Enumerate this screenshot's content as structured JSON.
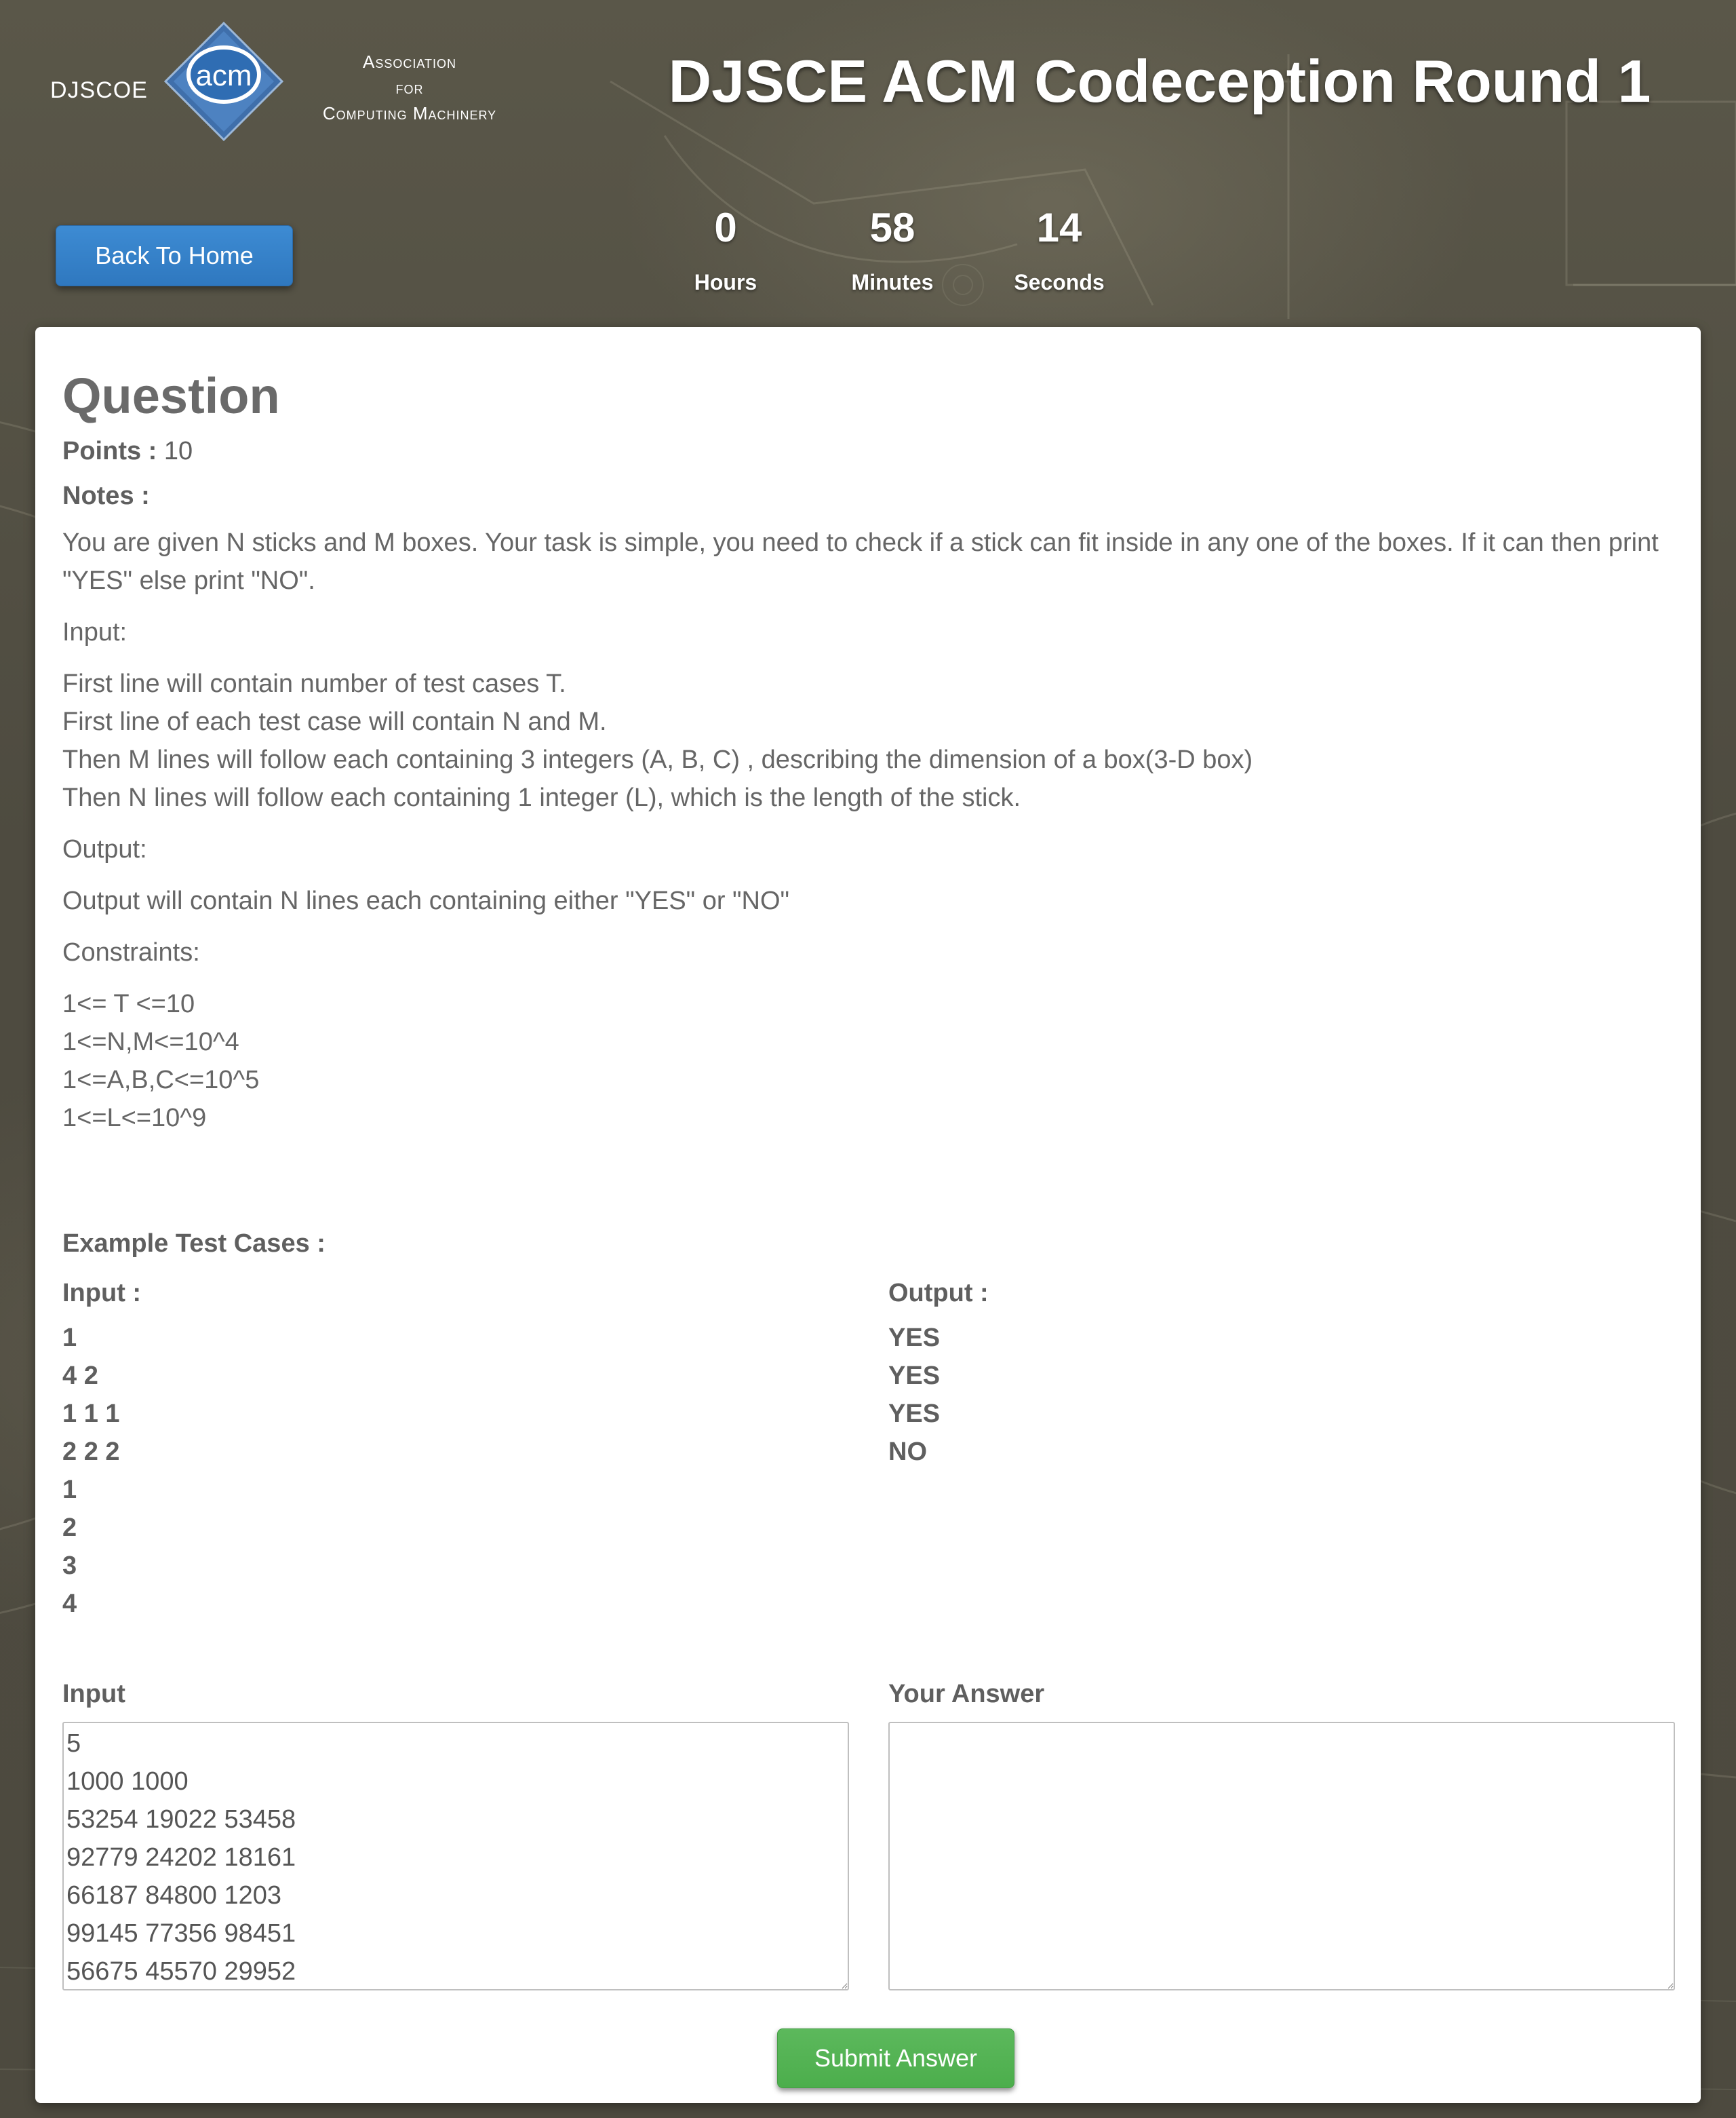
{
  "header": {
    "logo": {
      "djscoe": "DJSCOE",
      "acm": "acm",
      "org_lines": [
        "Association",
        "for",
        "Computing Machinery"
      ]
    },
    "title": "DJSCE ACM Codeception Round 1",
    "back_button": "Back To Home",
    "timer": {
      "hours_value": "0",
      "hours_label": "Hours",
      "minutes_value": "58",
      "minutes_label": "Minutes",
      "seconds_value": "14",
      "seconds_label": "Seconds"
    }
  },
  "question": {
    "heading": "Question",
    "points_label": "Points :",
    "points_value": "10",
    "notes_label": "Notes :",
    "description": "You are given N sticks and M boxes. Your task is simple, you need to check if a stick can fit inside in any one of the boxes. If it can then print \"YES\" else print \"NO\".",
    "input_heading": "Input:",
    "input_lines": [
      "First line will contain number of test cases T.",
      "First line of each test case will contain N and M.",
      "Then M lines will follow each containing 3 integers (A, B, C) , describing the dimension of a box(3-D box)",
      "Then N lines will follow each containing 1 integer (L), which is the length of the stick."
    ],
    "output_heading": "Output:",
    "output_text": "Output will contain N lines each containing either \"YES\" or \"NO\"",
    "constraints_heading": "Constraints:",
    "constraints": [
      "1<= T <=10",
      "1<=N,M<=10^4",
      "1<=A,B,C<=10^5",
      "1<=L<=10^9"
    ]
  },
  "examples": {
    "title": "Example Test Cases :",
    "input_label": "Input :",
    "input_lines": [
      "1",
      "4 2",
      "1 1 1",
      "2 2 2",
      "1",
      "2",
      "3",
      "4"
    ],
    "output_label": "Output :",
    "output_lines": [
      "YES",
      "YES",
      "YES",
      "NO"
    ]
  },
  "answer_form": {
    "input_label": "Input",
    "input_value": "5\n1000 1000\n53254 19022 53458\n92779 24202 18161\n66187 84800 1203\n99145 77356 98451\n56675 45570 29952",
    "answer_label": "Your Answer",
    "answer_value": "",
    "submit_button": "Submit Answer"
  },
  "colors": {
    "background": "#4f4c41",
    "primary_button": "#337ab7",
    "success_button": "#5cb85c",
    "text": "#5f5f5f"
  }
}
